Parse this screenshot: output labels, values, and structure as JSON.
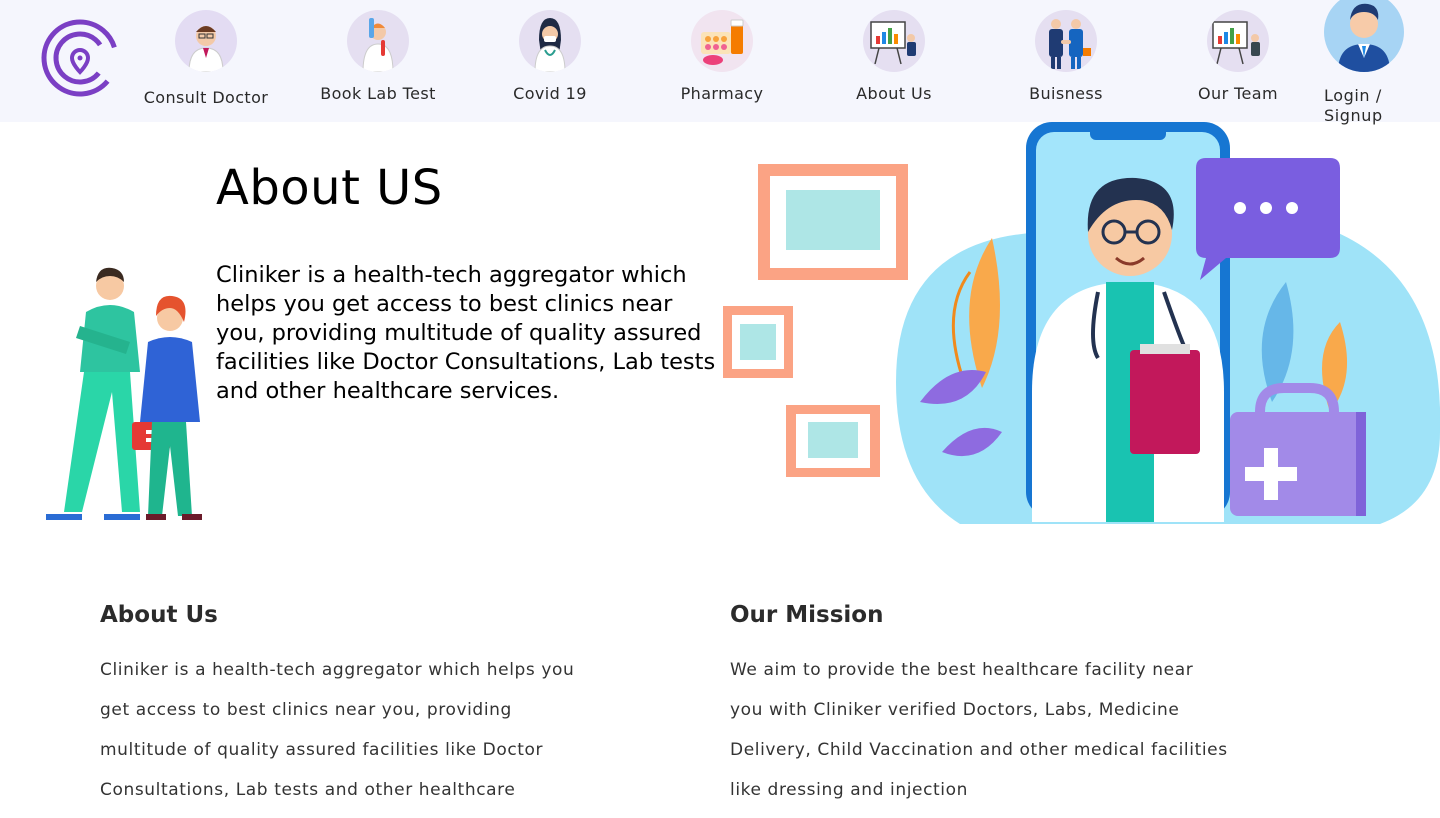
{
  "brand": {
    "logo_icon": "cliniker-logo",
    "color": "#7b3fc4"
  },
  "nav": {
    "items": [
      {
        "label": "Consult Doctor",
        "icon": "doctor-icon"
      },
      {
        "label": "Book Lab Test",
        "icon": "lab-test-icon"
      },
      {
        "label": "Covid 19",
        "icon": "covid-icon"
      },
      {
        "label": "Pharmacy",
        "icon": "pharmacy-icon"
      },
      {
        "label": "About Us",
        "icon": "presentation-icon"
      },
      {
        "label": "Buisness",
        "icon": "handshake-icon"
      },
      {
        "label": "Our Team",
        "icon": "team-icon"
      }
    ],
    "login_label": "Login / Signup"
  },
  "hero": {
    "title": "About US",
    "text": "Cliniker is a health-tech aggregator which helps you get access to best clinics near you, providing multitude of quality assured facilities like Doctor Consultations, Lab tests and other healthcare services."
  },
  "about": {
    "title": "About Us",
    "text": "Cliniker is a health-tech aggregator which helps you get access to best clinics near you, providing multitude of quality assured facilities like Doctor Consultations, Lab tests and other healthcare"
  },
  "mission": {
    "title": "Our Mission",
    "text": "We aim to provide the best healthcare facility near you with Cliniker verified Doctors, Labs, Medicine Delivery, Child Vaccination and other medical facilities like dressing and injection"
  },
  "colors": {
    "nav_bg": "#f5f6fd",
    "accent_purple": "#7b3fc4",
    "frame_orange": "#fba384",
    "frame_teal": "#aee6e6",
    "bubble_purple": "#7a5ee0"
  }
}
